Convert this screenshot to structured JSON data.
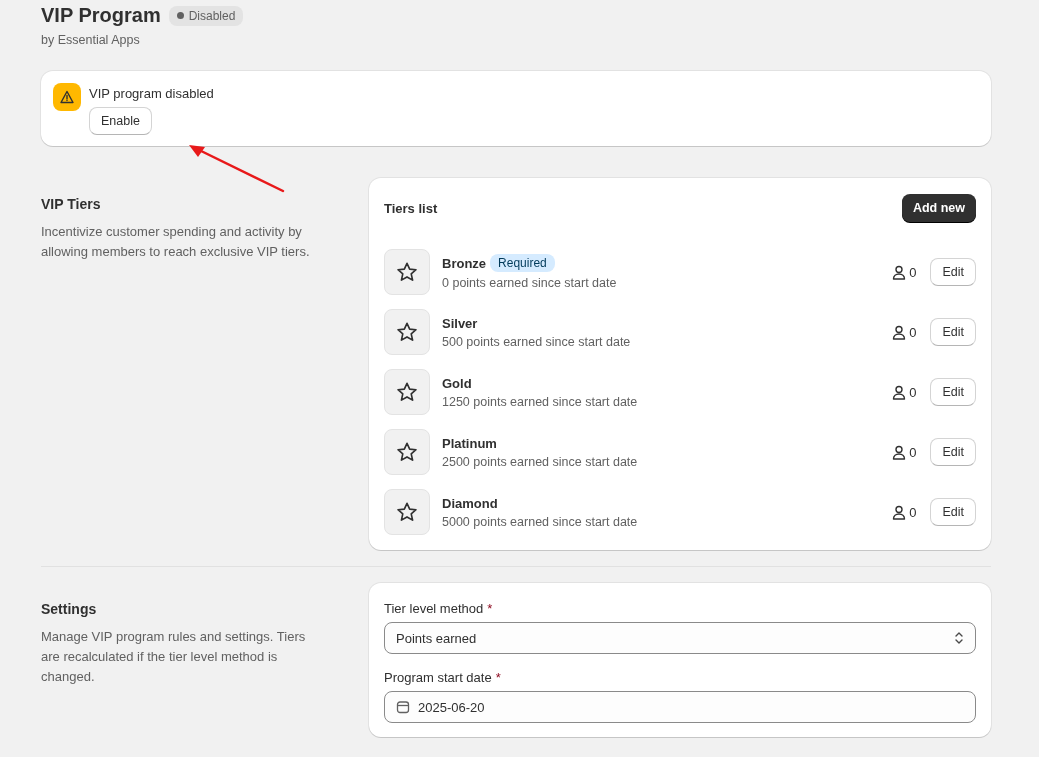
{
  "header": {
    "title": "VIP Program",
    "status": {
      "label": "Disabled",
      "enabled": false
    },
    "subtitle": "by Essential Apps"
  },
  "banner": {
    "message": "VIP program disabled",
    "button": "Enable",
    "annotation_arrow": true
  },
  "tiers_section": {
    "title": "VIP Tiers",
    "description": "Incentivize customer spending and activity by allowing members to reach exclusive VIP tiers.",
    "card_title": "Tiers list",
    "add_button": "Add new",
    "tiers": [
      {
        "name": "Bronze",
        "badge": "Required",
        "detail": "0 points earned since start date",
        "members": "0",
        "button": "Edit"
      },
      {
        "name": "Silver",
        "detail": "500 points earned since start date",
        "members": "0",
        "button": "Edit"
      },
      {
        "name": "Gold",
        "detail": "1250 points earned since start date",
        "members": "0",
        "button": "Edit"
      },
      {
        "name": "Platinum",
        "detail": "2500 points earned since start date",
        "members": "0",
        "button": "Edit"
      },
      {
        "name": "Diamond",
        "detail": "5000 points earned since start date",
        "members": "0",
        "button": "Edit"
      }
    ]
  },
  "settings_section": {
    "title": "Settings",
    "description": "Manage VIP program rules and settings. Tiers are recalculated if the tier level method is changed.",
    "fields": [
      {
        "kind": "select",
        "label": "Tier level method",
        "required_mark": "*",
        "value": "Points earned"
      },
      {
        "kind": "date",
        "label": "Program start date",
        "required_mark": "*",
        "value": "2025-06-20"
      }
    ]
  }
}
